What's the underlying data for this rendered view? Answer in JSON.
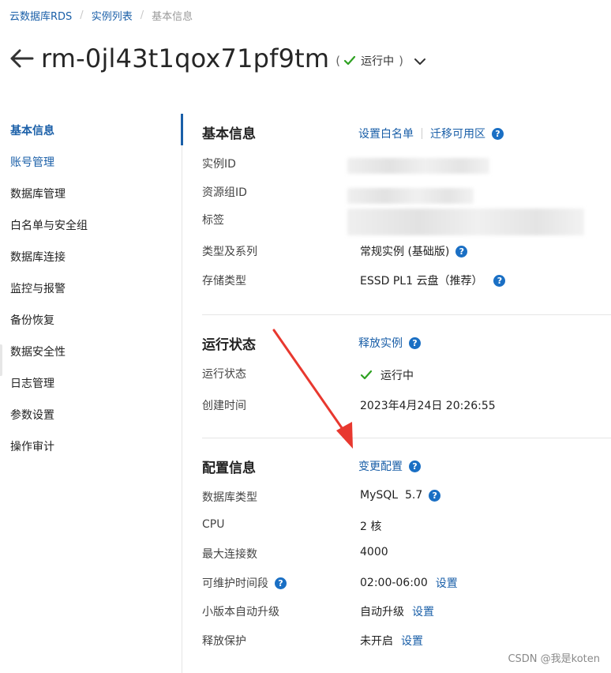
{
  "breadcrumb": [
    "云数据库RDS",
    "实例列表",
    "基本信息"
  ],
  "header": {
    "title": "rm-0jl43t1qox71pf9tm",
    "status_open": "(",
    "status_text": "运行中",
    "status_close": ")",
    "status_color": "#2ea121"
  },
  "sidebar": {
    "items": [
      {
        "label": "基本信息"
      },
      {
        "label": "账号管理"
      },
      {
        "label": "数据库管理"
      },
      {
        "label": "白名单与安全组"
      },
      {
        "label": "数据库连接"
      },
      {
        "label": "监控与报警"
      },
      {
        "label": "备份恢复"
      },
      {
        "label": "数据安全性"
      },
      {
        "label": "日志管理"
      },
      {
        "label": "参数设置"
      },
      {
        "label": "操作审计"
      }
    ]
  },
  "basic_info": {
    "title": "基本信息",
    "action_whitelist": "设置白名单",
    "action_migrate": "迁移可用区",
    "rows": [
      {
        "label": "实例ID"
      },
      {
        "label": "资源组ID"
      },
      {
        "label": "标签"
      },
      {
        "label": "类型及系列",
        "value": "常规实例 (基础版)"
      },
      {
        "label": "存储类型",
        "value": "ESSD PL1 云盘（推荐）"
      }
    ]
  },
  "run_status": {
    "title": "运行状态",
    "action_release": "释放实例",
    "rows": [
      {
        "label": "运行状态",
        "value": "运行中"
      },
      {
        "label": "创建时间",
        "value": "2023年4月24日 20:26:55"
      }
    ]
  },
  "config": {
    "title": "配置信息",
    "action_change": "变更配置",
    "rows": [
      {
        "label": "数据库类型",
        "value": "MySQL  5.7"
      },
      {
        "label": "CPU",
        "value": "2 核"
      },
      {
        "label": "最大连接数",
        "value": "4000"
      },
      {
        "label": "可维护时间段",
        "value": "02:00-06:00",
        "link": "设置"
      },
      {
        "label": "小版本自动升级",
        "value": "自动升级",
        "link": "设置"
      },
      {
        "label": "释放保护",
        "value": "未开启",
        "link": "设置"
      }
    ]
  },
  "colors": {
    "link": "#1a5fa8",
    "help": "#1a6fc4",
    "annotation_arrow": "#e8382f"
  },
  "watermark": "CSDN @我是koten"
}
